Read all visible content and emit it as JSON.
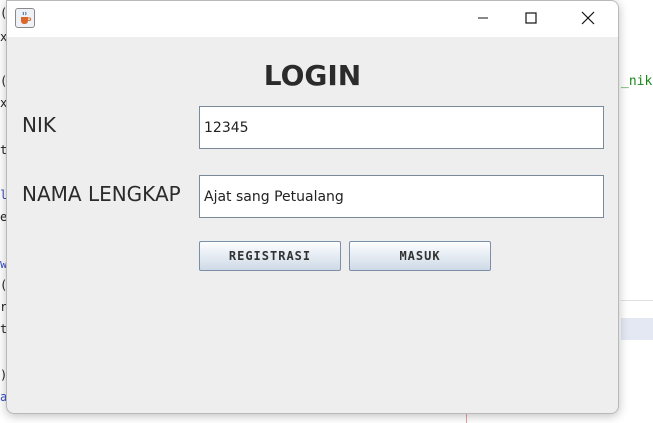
{
  "window": {
    "heading": "LOGIN",
    "controls": {
      "minimize": "minimize",
      "maximize": "maximize",
      "close": "close"
    },
    "icon": "java-cup-icon"
  },
  "form": {
    "nik_label": "NIK",
    "nik_value": "12345",
    "nama_label": "NAMA LENGKAP",
    "nama_value": "Ajat sang Petualang"
  },
  "buttons": {
    "registrasi": "REGISTRASI",
    "masuk": "MASUK"
  },
  "background": {
    "right_code_fragment": "_nik",
    "gutter_chars": [
      "(",
      "x",
      "(",
      "x",
      "t",
      "l",
      "e",
      "w",
      "(",
      "r",
      "t",
      ")",
      "a"
    ]
  },
  "colors": {
    "window_bg": "#eeeeee",
    "titlebar_bg": "#ffffff",
    "text": "#2b2b2b"
  }
}
